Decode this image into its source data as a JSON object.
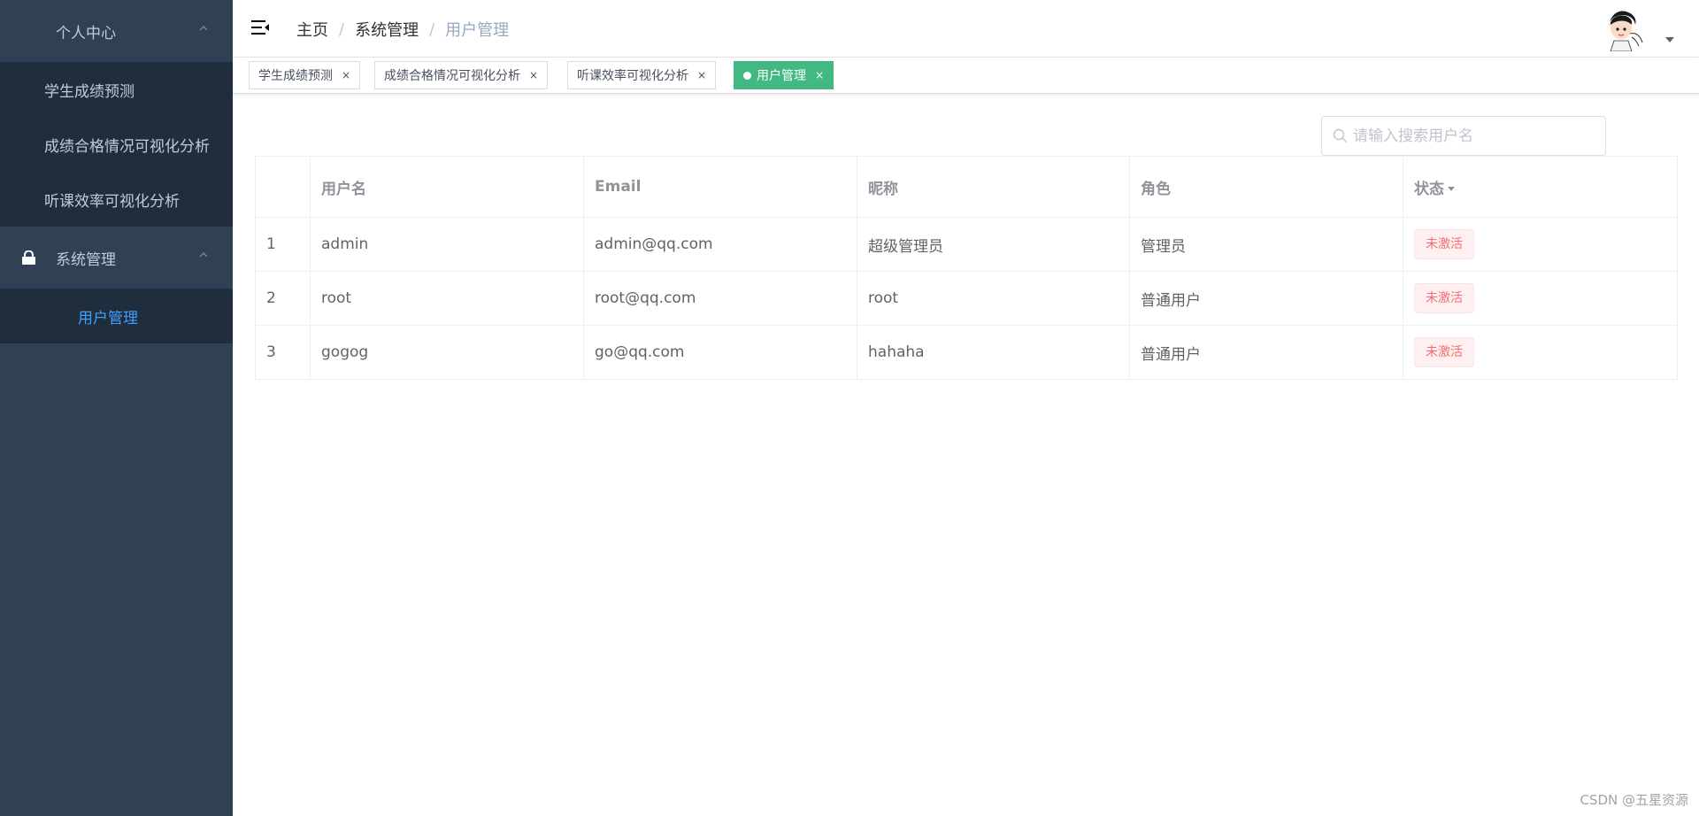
{
  "sidebar": {
    "group1": {
      "title": "个人中心"
    },
    "group1_items": [
      {
        "label": "学生成绩预测"
      },
      {
        "label": "成绩合格情况可视化分析"
      },
      {
        "label": "听课效率可视化分析"
      }
    ],
    "group2": {
      "title": "系统管理",
      "icon": "lock-icon"
    },
    "group2_items": [
      {
        "label": "用户管理",
        "active": true
      }
    ]
  },
  "breadcrumb": [
    "主页",
    "系统管理",
    "用户管理"
  ],
  "tags": [
    {
      "label": "学生成绩预测",
      "close": "×"
    },
    {
      "label": "成绩合格情况可视化分析",
      "close": "×"
    },
    {
      "label": "听课效率可视化分析",
      "close": "×"
    },
    {
      "label": "用户管理",
      "close": "×",
      "active": true
    }
  ],
  "search": {
    "placeholder": "请输入搜索用户名",
    "value": ""
  },
  "table": {
    "headers": [
      "",
      "用户名",
      "Email",
      "昵称",
      "角色",
      "状态"
    ],
    "rows": [
      {
        "index": "1",
        "username": "admin",
        "email": "admin@qq.com",
        "nickname": "超级管理员",
        "role": "管理员",
        "status": "未激活"
      },
      {
        "index": "2",
        "username": "root",
        "email": "root@qq.com",
        "nickname": "root",
        "role": "普通用户",
        "status": "未激活"
      },
      {
        "index": "3",
        "username": "gogog",
        "email": "go@qq.com",
        "nickname": "hahaha",
        "role": "普通用户",
        "status": "未激活"
      }
    ]
  },
  "watermark": "CSDN @五星资源",
  "colors": {
    "sidebar_bg": "#304156",
    "submenu_bg": "#1f2d3d",
    "active_menu": "#409eff",
    "active_tag": "#42b983",
    "status_danger": "#f56c6c"
  }
}
